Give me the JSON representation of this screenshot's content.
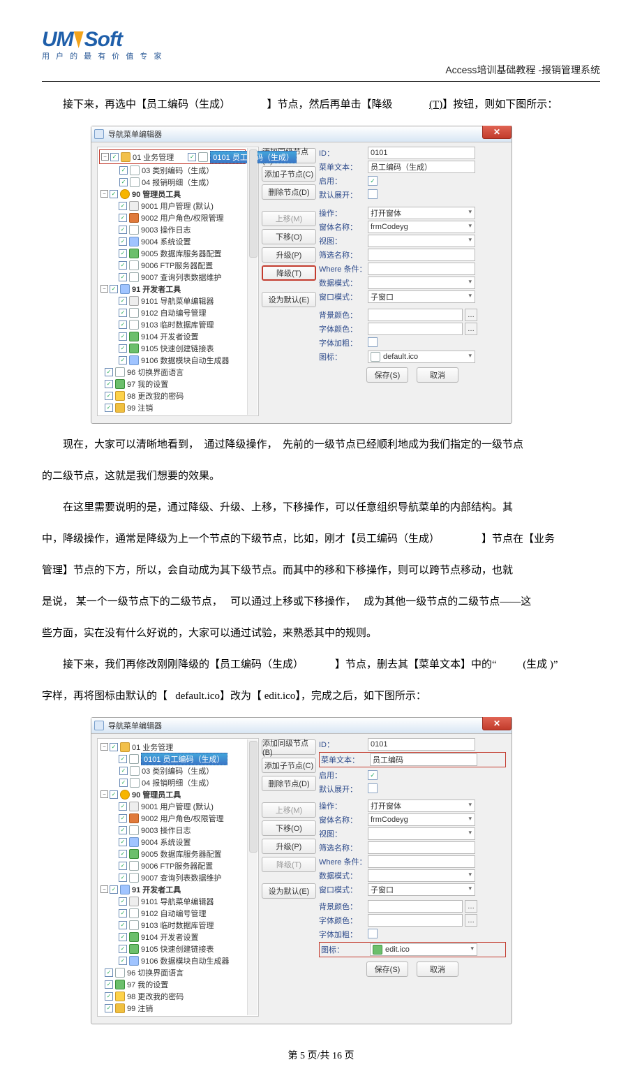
{
  "header": {
    "logo_main_left": "UM",
    "logo_main_right": "Soft",
    "logo_sub": "用 户 的 最 有 价 值 专 家",
    "doc_title_prefix": "Access",
    "doc_title_rest": "培训基础教程  -报销管理系统"
  },
  "intro_para": {
    "a": "接下来，再选中【员工编码（生成）",
    "b_gap": "      ",
    "c": "】节点，然后再单击【降级",
    "d_gap": "     ",
    "e": "(T)",
    "f": "】按钮，则如下图所示："
  },
  "shot1": {
    "title": "导航菜单编辑器",
    "tree": {
      "root_01": "01 业务管理",
      "sel_0101": "0101 员工编码（生成）",
      "n03": "03 类别编码（生成）",
      "n04": "04 报销明细（生成）",
      "root_90": "90 管理员工具",
      "n9001": "9001 用户管理 (默认)",
      "n9002": "9002 用户角色/权限管理",
      "n9003": "9003 操作日志",
      "n9004": "9004 系统设置",
      "n9005": "9005 数据库服务器配置",
      "n9006": "9006 FTP服务器配置",
      "n9007": "9007 查询列表数据维护",
      "root_91": "91 开发者工具",
      "n9101": "9101 导航菜单编辑器",
      "n9102": "9102 自动编号管理",
      "n9103": "9103 临时数据库管理",
      "n9104": "9104 开发者设置",
      "n9105": "9105 快速创建链接表",
      "n9106": "9106 数据模块自动生成器",
      "n96": "96 切换界面语言",
      "n97": "97 我的设置",
      "n98": "98 更改我的密码",
      "n99": "99 注销"
    },
    "buttons": {
      "add_same": "添加同级节点(B)",
      "add_child": "添加子节点(C)",
      "del": "删除节点(D)",
      "up": "上移(M)",
      "down": "下移(O)",
      "promote": "升级(P)",
      "demote": "降级(T)",
      "set_default": "设为默认(E)"
    },
    "form": {
      "id_lbl": "ID：",
      "id_val": "0101",
      "menu_lbl": "菜单文本：",
      "menu_val": "员工编码（生成）",
      "enable_lbl": "启用：",
      "expand_lbl": "默认展开：",
      "action_lbl": "操作：",
      "action_val": "打开窗体",
      "form_lbl": "窗体名称：",
      "form_val": "frmCodeyg",
      "view_lbl": "视图：",
      "filter_lbl": "筛选名称：",
      "where_lbl": "Where 条件：",
      "datamode_lbl": "数据模式：",
      "winmode_lbl": "窗口模式：",
      "winmode_val": "子窗口",
      "bg_lbl": "背景颜色：",
      "font_lbl": "字体颜色：",
      "bold_lbl": "字体加粗：",
      "icon_lbl": "图标：",
      "icon_val": "default.ico",
      "save": "保存(S)",
      "cancel": "取消"
    }
  },
  "mid": {
    "p1a": "现在，大家可以清晰地看到，",
    "p1b": "通过降级操作，",
    "p1c": "先前的一级节点已经顺利地成为我们指定的一级节点",
    "p1d": "的二级节点，这就是我们想要的效果。",
    "p2": "在这里需要说明的是，通过降级、升级、上移，下移操作，可以任意组织导航菜单的内部结构。其",
    "p3a": "中，降级操作，通常是降级为上一个节点的下级节点，比如，刚才【员工编码（生成）",
    "p3b": "】节点在【业务",
    "p4": "管理】节点的下方，所以，会自动成为其下级节点。而其中的移和下移操作，则可以跨节点移动，也就",
    "p5a": "是说，",
    "p5b": "某一个一级节点下的二级节点，",
    "p5c": "可以通过上移或下移操作，",
    "p5d": "成为其他一级节点的二级节点——这",
    "p6": "些方面，实在没有什么好说的，大家可以通过试验，来熟悉其中的规则。",
    "p7a": "接下来，我们再修改刚刚降级的【员工编码（生成）",
    "p7b": "】节点，删去其【菜单文本】中的“",
    "p7c": "(生成 )”",
    "p8a": "字样，再将图标由默认的【",
    "p8b": "default.ico",
    "p8c": "】改为【",
    "p8d": "edit.ico",
    "p8e": "】，完成之后，如下图所示："
  },
  "shot2": {
    "title": "导航菜单编辑器",
    "tree": {
      "root_01": "01 业务管理",
      "sel_0101": "0101 员工编码（生成）",
      "n03": "03 类别编码（生成）",
      "n04": "04 报销明细（生成）",
      "root_90": "90 管理员工具",
      "n9001": "9001 用户管理 (默认)",
      "n9002": "9002 用户角色/权限管理",
      "n9003": "9003 操作日志",
      "n9004": "9004 系统设置",
      "n9005": "9005 数据库服务器配置",
      "n9006": "9006 FTP服务器配置",
      "n9007": "9007 查询列表数据维护",
      "root_91": "91 开发者工具",
      "n9101": "9101 导航菜单编辑器",
      "n9102": "9102 自动编号管理",
      "n9103": "9103 临时数据库管理",
      "n9104": "9104 开发者设置",
      "n9105": "9105 快速创建链接表",
      "n9106": "9106 数据模块自动生成器",
      "n96": "96 切换界面语言",
      "n97": "97 我的设置",
      "n98": "98 更改我的密码",
      "n99": "99 注销"
    },
    "form": {
      "id_lbl": "ID：",
      "id_val": "0101",
      "menu_lbl": "菜单文本：",
      "menu_val": "员工编码",
      "enable_lbl": "启用：",
      "expand_lbl": "默认展开：",
      "action_lbl": "操作：",
      "action_val": "打开窗体",
      "form_lbl": "窗体名称：",
      "form_val": "frmCodeyg",
      "view_lbl": "视图：",
      "filter_lbl": "筛选名称：",
      "where_lbl": "Where 条件：",
      "datamode_lbl": "数据模式：",
      "winmode_lbl": "窗口模式：",
      "winmode_val": "子窗口",
      "bg_lbl": "背景颜色：",
      "font_lbl": "字体颜色：",
      "bold_lbl": "字体加粗：",
      "icon_lbl": "图标：",
      "icon_val": "edit.ico",
      "save": "保存(S)",
      "cancel": "取消"
    }
  },
  "footer": {
    "a": "第 ",
    "page": "5",
    "b": " 页/共 ",
    "total": "16",
    "c": " 页"
  }
}
